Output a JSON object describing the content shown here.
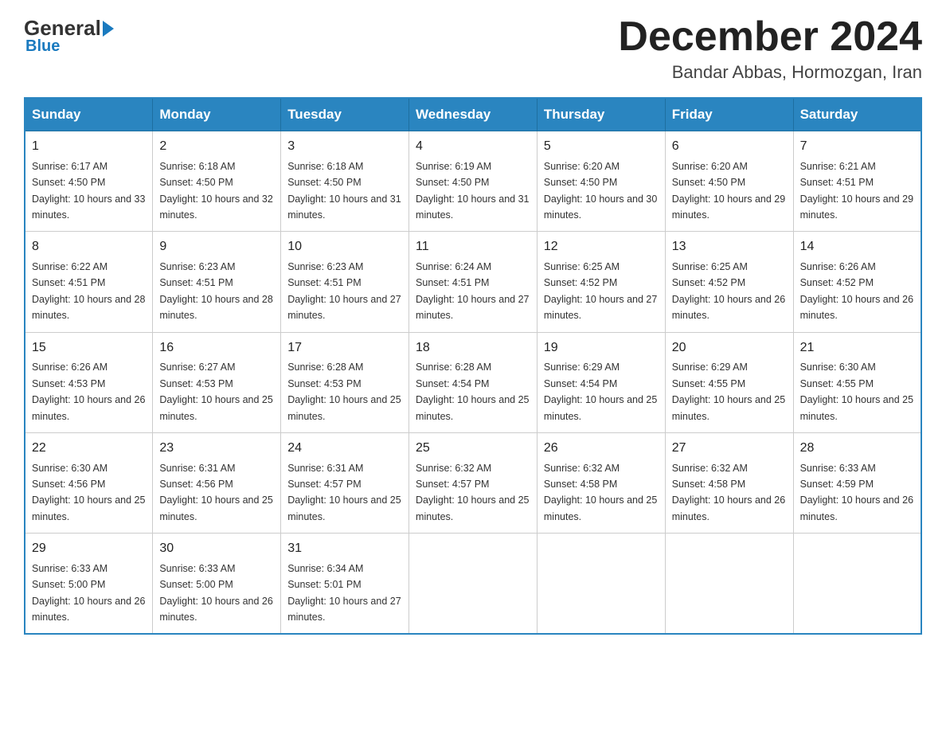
{
  "header": {
    "logo_general": "General",
    "logo_blue": "Blue",
    "month_title": "December 2024",
    "location": "Bandar Abbas, Hormozgan, Iran"
  },
  "days_of_week": [
    "Sunday",
    "Monday",
    "Tuesday",
    "Wednesday",
    "Thursday",
    "Friday",
    "Saturday"
  ],
  "weeks": [
    [
      {
        "day": "1",
        "sunrise": "6:17 AM",
        "sunset": "4:50 PM",
        "daylight": "10 hours and 33 minutes."
      },
      {
        "day": "2",
        "sunrise": "6:18 AM",
        "sunset": "4:50 PM",
        "daylight": "10 hours and 32 minutes."
      },
      {
        "day": "3",
        "sunrise": "6:18 AM",
        "sunset": "4:50 PM",
        "daylight": "10 hours and 31 minutes."
      },
      {
        "day": "4",
        "sunrise": "6:19 AM",
        "sunset": "4:50 PM",
        "daylight": "10 hours and 31 minutes."
      },
      {
        "day": "5",
        "sunrise": "6:20 AM",
        "sunset": "4:50 PM",
        "daylight": "10 hours and 30 minutes."
      },
      {
        "day": "6",
        "sunrise": "6:20 AM",
        "sunset": "4:50 PM",
        "daylight": "10 hours and 29 minutes."
      },
      {
        "day": "7",
        "sunrise": "6:21 AM",
        "sunset": "4:51 PM",
        "daylight": "10 hours and 29 minutes."
      }
    ],
    [
      {
        "day": "8",
        "sunrise": "6:22 AM",
        "sunset": "4:51 PM",
        "daylight": "10 hours and 28 minutes."
      },
      {
        "day": "9",
        "sunrise": "6:23 AM",
        "sunset": "4:51 PM",
        "daylight": "10 hours and 28 minutes."
      },
      {
        "day": "10",
        "sunrise": "6:23 AM",
        "sunset": "4:51 PM",
        "daylight": "10 hours and 27 minutes."
      },
      {
        "day": "11",
        "sunrise": "6:24 AM",
        "sunset": "4:51 PM",
        "daylight": "10 hours and 27 minutes."
      },
      {
        "day": "12",
        "sunrise": "6:25 AM",
        "sunset": "4:52 PM",
        "daylight": "10 hours and 27 minutes."
      },
      {
        "day": "13",
        "sunrise": "6:25 AM",
        "sunset": "4:52 PM",
        "daylight": "10 hours and 26 minutes."
      },
      {
        "day": "14",
        "sunrise": "6:26 AM",
        "sunset": "4:52 PM",
        "daylight": "10 hours and 26 minutes."
      }
    ],
    [
      {
        "day": "15",
        "sunrise": "6:26 AM",
        "sunset": "4:53 PM",
        "daylight": "10 hours and 26 minutes."
      },
      {
        "day": "16",
        "sunrise": "6:27 AM",
        "sunset": "4:53 PM",
        "daylight": "10 hours and 25 minutes."
      },
      {
        "day": "17",
        "sunrise": "6:28 AM",
        "sunset": "4:53 PM",
        "daylight": "10 hours and 25 minutes."
      },
      {
        "day": "18",
        "sunrise": "6:28 AM",
        "sunset": "4:54 PM",
        "daylight": "10 hours and 25 minutes."
      },
      {
        "day": "19",
        "sunrise": "6:29 AM",
        "sunset": "4:54 PM",
        "daylight": "10 hours and 25 minutes."
      },
      {
        "day": "20",
        "sunrise": "6:29 AM",
        "sunset": "4:55 PM",
        "daylight": "10 hours and 25 minutes."
      },
      {
        "day": "21",
        "sunrise": "6:30 AM",
        "sunset": "4:55 PM",
        "daylight": "10 hours and 25 minutes."
      }
    ],
    [
      {
        "day": "22",
        "sunrise": "6:30 AM",
        "sunset": "4:56 PM",
        "daylight": "10 hours and 25 minutes."
      },
      {
        "day": "23",
        "sunrise": "6:31 AM",
        "sunset": "4:56 PM",
        "daylight": "10 hours and 25 minutes."
      },
      {
        "day": "24",
        "sunrise": "6:31 AM",
        "sunset": "4:57 PM",
        "daylight": "10 hours and 25 minutes."
      },
      {
        "day": "25",
        "sunrise": "6:32 AM",
        "sunset": "4:57 PM",
        "daylight": "10 hours and 25 minutes."
      },
      {
        "day": "26",
        "sunrise": "6:32 AM",
        "sunset": "4:58 PM",
        "daylight": "10 hours and 25 minutes."
      },
      {
        "day": "27",
        "sunrise": "6:32 AM",
        "sunset": "4:58 PM",
        "daylight": "10 hours and 26 minutes."
      },
      {
        "day": "28",
        "sunrise": "6:33 AM",
        "sunset": "4:59 PM",
        "daylight": "10 hours and 26 minutes."
      }
    ],
    [
      {
        "day": "29",
        "sunrise": "6:33 AM",
        "sunset": "5:00 PM",
        "daylight": "10 hours and 26 minutes."
      },
      {
        "day": "30",
        "sunrise": "6:33 AM",
        "sunset": "5:00 PM",
        "daylight": "10 hours and 26 minutes."
      },
      {
        "day": "31",
        "sunrise": "6:34 AM",
        "sunset": "5:01 PM",
        "daylight": "10 hours and 27 minutes."
      },
      null,
      null,
      null,
      null
    ]
  ]
}
